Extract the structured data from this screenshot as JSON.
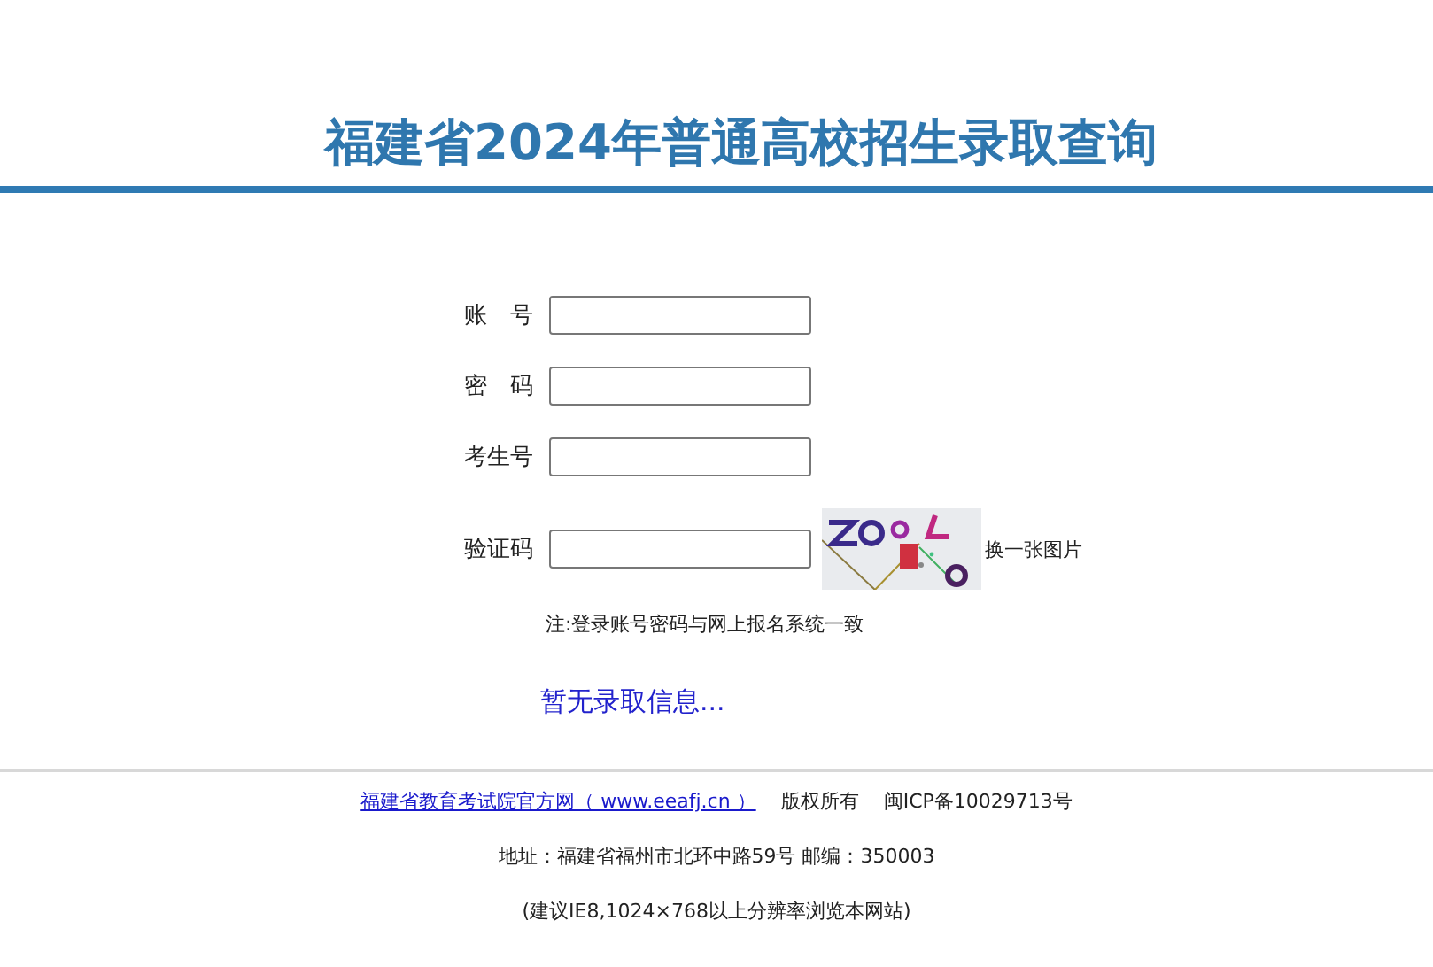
{
  "header": {
    "title": "福建省2024年普通高校招生录取查询"
  },
  "form": {
    "fields": [
      {
        "label": "账　号",
        "kind": "text"
      },
      {
        "label": "密　码",
        "kind": "text"
      },
      {
        "label": "考生号",
        "kind": "text"
      },
      {
        "label": "验证码",
        "kind": "captcha",
        "refresh_link": "换一张图片"
      }
    ],
    "note": "注:登录账号密码与网上报名系统一致"
  },
  "result": {
    "message": "暂无录取信息..."
  },
  "footer": {
    "link": "福建省教育考试院官方网（ www.eeafj.cn ）",
    "copyright": "版权所有",
    "icp": "闽ICP备10029713号",
    "address": "地址：福建省福州市北环中路59号 邮编：350003",
    "advice": "(建议IE8,1024×768以上分辨率浏览本网站)"
  }
}
